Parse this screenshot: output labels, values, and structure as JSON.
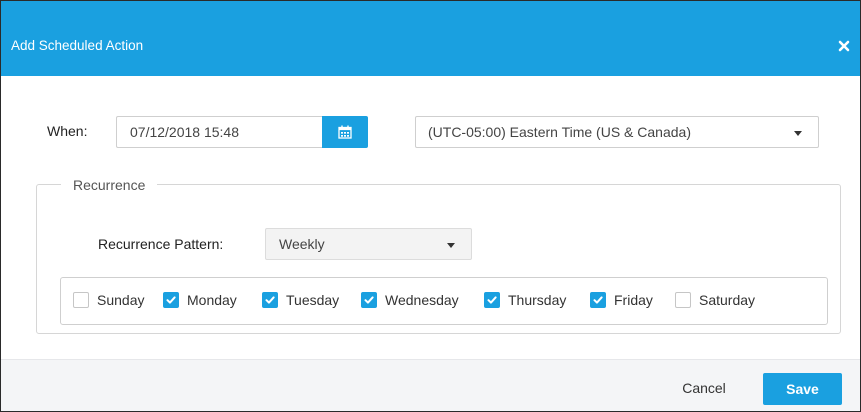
{
  "dialog": {
    "title": "Add Scheduled Action",
    "close_icon": "close-icon"
  },
  "when": {
    "label": "When:",
    "datetime_value": "07/12/2018 15:48",
    "calendar_icon": "calendar-icon",
    "timezone_value": "(UTC-05:00) Eastern Time (US & Canada)"
  },
  "recurrence": {
    "legend": "Recurrence",
    "pattern_label": "Recurrence Pattern:",
    "pattern_value": "Weekly",
    "days": [
      {
        "label": "Sunday",
        "checked": false
      },
      {
        "label": "Monday",
        "checked": true
      },
      {
        "label": "Tuesday",
        "checked": true
      },
      {
        "label": "Wednesday",
        "checked": true
      },
      {
        "label": "Thursday",
        "checked": true
      },
      {
        "label": "Friday",
        "checked": true
      },
      {
        "label": "Saturday",
        "checked": false
      }
    ]
  },
  "footer": {
    "cancel_label": "Cancel",
    "save_label": "Save"
  },
  "colors": {
    "accent": "#1aa0e0",
    "checkbox_border": "#c6c6c6",
    "footer_bg": "#f4f5f7"
  }
}
